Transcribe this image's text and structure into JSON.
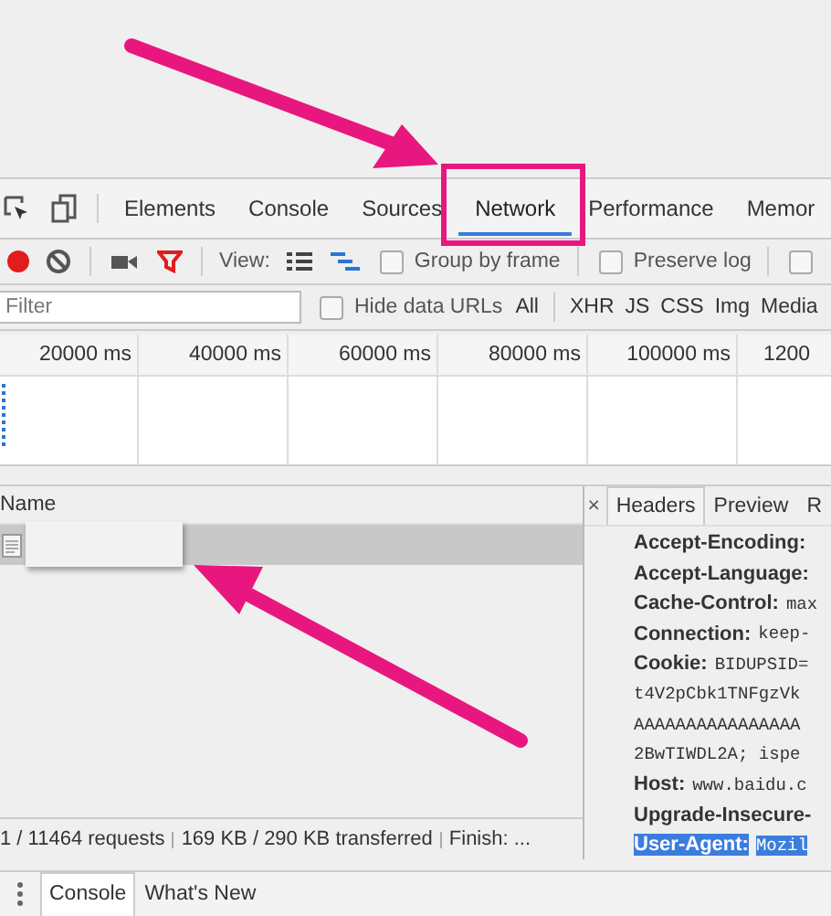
{
  "panel_tabs": [
    {
      "label": "Elements",
      "selected": false
    },
    {
      "label": "Console",
      "selected": false
    },
    {
      "label": "Sources",
      "selected": false
    },
    {
      "label": "Network",
      "selected": true
    },
    {
      "label": "Performance",
      "selected": false
    },
    {
      "label": "Memor",
      "selected": false
    }
  ],
  "toolbar": {
    "recording": true,
    "view_label": "View:",
    "options": [
      {
        "label": "Group by frame",
        "checked": false
      },
      {
        "label": "Preserve log",
        "checked": false
      },
      {
        "checked": false
      }
    ]
  },
  "filter": {
    "placeholder": "Filter",
    "hide_data_urls": {
      "label": "Hide data URLs",
      "checked": false
    },
    "types": [
      "All",
      "XHR",
      "JS",
      "CSS",
      "Img",
      "Media"
    ]
  },
  "timeline": {
    "ticks": [
      "20000 ms",
      "40000 ms",
      "60000 ms",
      "80000 ms",
      "100000 ms",
      "1200"
    ]
  },
  "requests": {
    "column": "Name",
    "rows": [
      {
        "selected": true
      }
    ]
  },
  "details": {
    "close": "×",
    "tabs": [
      {
        "label": "Headers",
        "selected": true
      },
      {
        "label": "Preview",
        "selected": false
      },
      {
        "label": "R",
        "selected": false
      }
    ],
    "lines": [
      {
        "name": "Accept-Encoding:",
        "selected": false
      },
      {
        "name": "Accept-Language:",
        "selected": false
      },
      {
        "name": "Cache-Control:",
        "value": "max",
        "selected": false
      },
      {
        "name": "Connection:",
        "value": "keep-",
        "selected": false
      },
      {
        "name": "Cookie:",
        "value": "BIDUPSID=",
        "selected": false
      },
      {
        "value": "t4V2pCbk1TNFgzVk",
        "selected": false
      },
      {
        "value": "AAAAAAAAAAAAAAAA",
        "selected": false
      },
      {
        "value": "2BwTIWDL2A; ispe",
        "selected": false
      },
      {
        "name": "Host:",
        "value": "www.baidu.c",
        "selected": false
      },
      {
        "name": "Upgrade-Insecure-",
        "selected": false
      },
      {
        "name": "User-Agent:",
        "value": "Mozil",
        "selected": true
      }
    ]
  },
  "status_bar": [
    "1 / 11464 requests",
    "169 KB / 290 KB transferred",
    "Finish: ..."
  ],
  "drawer_tabs": [
    {
      "label": "Console",
      "selected": true
    },
    {
      "label": "What's New",
      "selected": false
    }
  ]
}
